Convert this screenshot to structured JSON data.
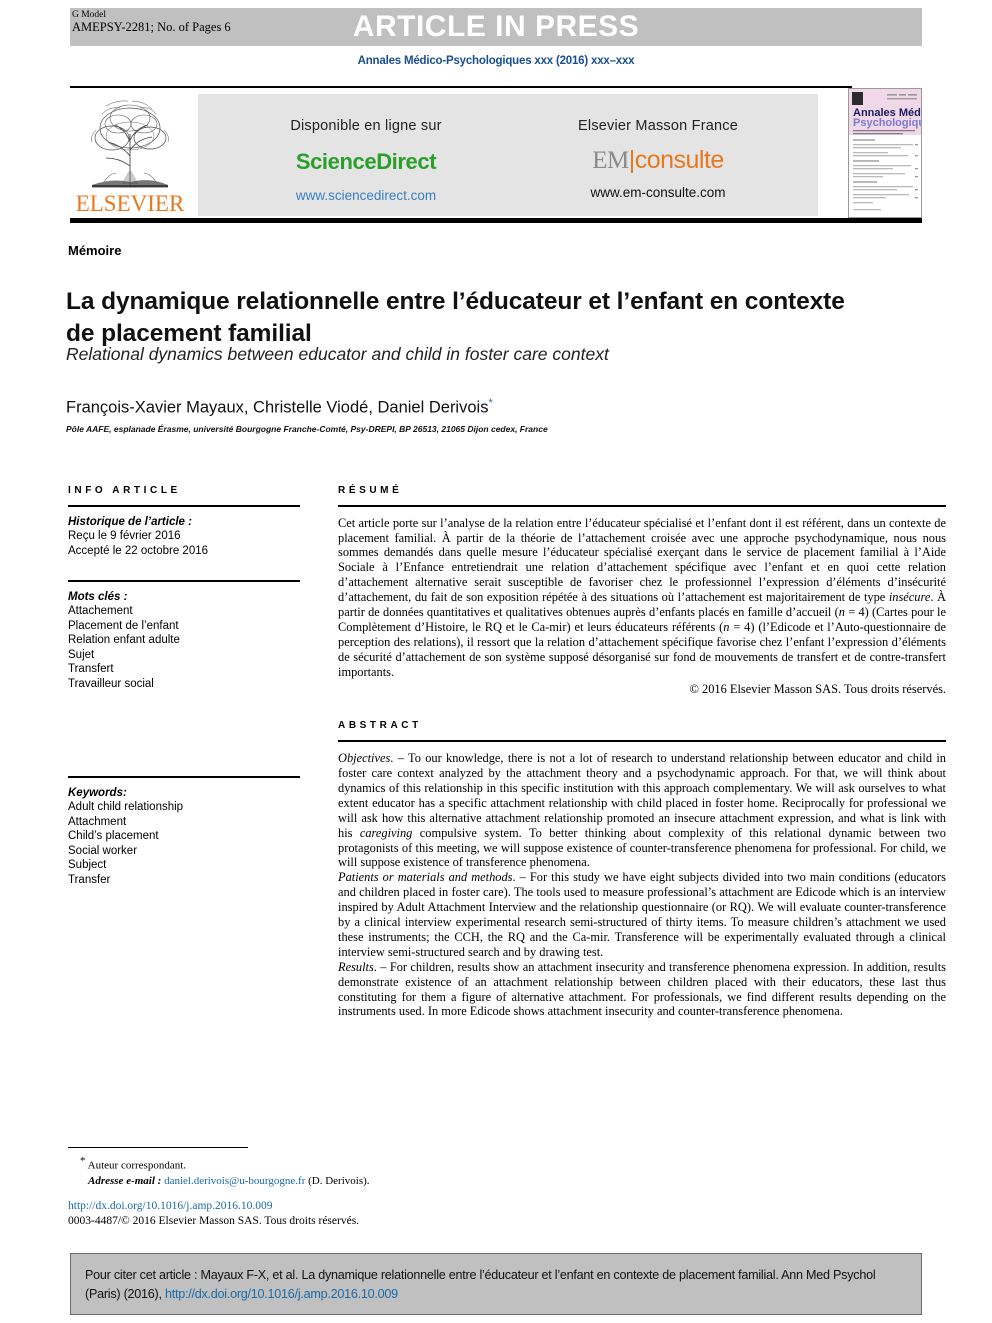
{
  "masthead": {
    "banner_text": "ARTICLE IN PRESS",
    "g_model_label": "G Model",
    "model_id": "AMEPSY-2281; No. of Pages 6",
    "journal_line": "Annales Médico-Psychologiques xxx (2016) xxx–xxx"
  },
  "banner": {
    "elsevier_wordmark": "ELSEVIER",
    "sciencedirect": {
      "label": "Disponible en ligne sur",
      "logo": "ScienceDirect",
      "url": "www.sciencedirect.com"
    },
    "emconsulte": {
      "label": "Elsevier Masson France",
      "logo_part1": "EM",
      "logo_part2": "consulte",
      "url": "www.em-consulte.com"
    },
    "cover": {
      "line1": "Annales Médico",
      "line2": "Psychologiques"
    }
  },
  "article": {
    "section_label": "Mémoire",
    "title_fr": "La dynamique relationnelle entre l’éducateur et l’enfant en contexte de placement familial",
    "title_en": "Relational dynamics between educator and child in foster care context",
    "authors": "François-Xavier Mayaux, Christelle Viodé, Daniel Derivois",
    "affiliation": "Pôle AAFE, esplanade Érasme, université Bourgogne Franche-Comté, Psy-DREPI, BP 26513, 21065 Dijon cedex, France"
  },
  "info_article": {
    "heading": "INFO ARTICLE",
    "history_label": "Historique de l’article :",
    "received": "Reçu le 9 février 2016",
    "accepted": "Accepté le 22 octobre 2016",
    "keywords_label": "Mots clés :",
    "keywords": [
      "Attachement",
      "Placement de l’enfant",
      "Relation enfant adulte",
      "Sujet",
      "Transfert",
      "Travailleur social"
    ],
    "keywords_en_label": "Keywords:",
    "keywords_en": [
      "Adult child relationship",
      "Attachment",
      "Child’s placement",
      "Social worker",
      "Subject",
      "Transfer"
    ]
  },
  "resume": {
    "heading": "RÉSUMÉ",
    "body_part1": "Cet article porte sur l’analyse de la relation entre l’éducateur spécialisé et l’enfant dont il est référent, dans un contexte de placement familial. À partir de la théorie de l’attachement croisée avec une approche psychodynamique, nous nous sommes demandés dans quelle mesure l’éducateur spécialisé exerçant dans le service de placement familial à l’Aide Sociale à l’Enfance entretiendrait une relation d’attachement spécifique avec l’enfant et en quoi cette relation d’attachement alternative serait susceptible de favoriser chez le professionnel l’expression d’éléments d’insécurité d’attachement, du fait de son exposition répétée à des situations où l’attachement est majoritairement de type ",
    "italic1": "insécure",
    "body_part2": ". À partir de données quantitatives et qualitatives obtenues auprès d’enfants placés en famille d’accueil (",
    "italic2": "n",
    "body_part3": " = 4) (Cartes pour le Complètement d’Histoire, le RQ et le Ca-mir) et leurs éducateurs référents (",
    "italic3": "n",
    "body_part4": " = 4) (l’Edicode et l’Auto-questionnaire de perception des relations), il ressort que la relation d’attachement spécifique favorise chez l’enfant l’expression d’éléments de sécurité d’attachement de son système supposé désorganisé sur fond de mouvements de transfert et de contre-transfert importants.",
    "copyright": "© 2016 Elsevier Masson SAS. Tous droits réservés."
  },
  "abstract": {
    "heading": "ABSTRACT",
    "objectives_label": "Objectives",
    "objectives_body": ". – To our knowledge, there is not a lot of research to understand relationship between educator and child in foster care context analyzed by the attachment theory and a psychodynamic approach. For that, we will think about dynamics of this relationship in this specific institution with this approach complementary. We will ask ourselves to what extent educator has a specific attachment relationship with child placed in foster home. Reciprocally for professional we will ask how this alternative attachment relationship promoted an insecure attachment expression, and what is link with his ",
    "objectives_italic": "caregiving",
    "objectives_body2": " compulsive system. To better thinking about complexity of this relational dynamic between two protagonists of this meeting, we will suppose existence of counter-transference phenomena for professional. For child, we will suppose existence of transference phenomena.",
    "methods_label": "Patients or materials and methods",
    "methods_body": ". – For this study we have eight subjects divided into two main conditions (educators and children placed in foster care). The tools used to measure professional’s attachment are Edicode which is an interview inspired by Adult Attachment Interview and the relationship questionnaire (or RQ). We will evaluate counter-transference by a clinical interview experimental research semi-structured of thirty items. To measure children’s attachment we used these instruments; the CCH, the RQ and the Ca-mir. Transference will be experimentally evaluated through a clinical interview semi-structured search and by drawing test.",
    "results_label": "Results",
    "results_body": ". – For children, results show an attachment insecurity and transference phenomena expression. In addition, results demonstrate existence of an attachment relationship between children placed with their educators, these last thus constituting for them a figure of alternative attachment. For professionals, we find different results depending on the instruments used. In more Edicode shows attachment insecurity and counter-transference phenomena."
  },
  "footer": {
    "corresponding_author": "Auteur correspondant.",
    "email_label": "Adresse e-mail :",
    "email": "daniel.derivois@u-bourgogne.fr",
    "email_suffix": "(D. Derivois).",
    "doi": "http://dx.doi.org/10.1016/j.amp.2016.10.009",
    "issn_line": "0003-4487/© 2016 Elsevier Masson SAS. Tous droits réservés."
  },
  "citation": {
    "text_part1": "Pour citer cet article : Mayaux F-X, et al. La dynamique relationnelle entre l’éducateur et l’enfant en contexte de placement familial. Ann Med Psychol (Paris) (2016), ",
    "link": "http://dx.doi.org/10.1016/j.amp.2016.10.009"
  },
  "colors": {
    "link": "#1a6aa8",
    "elsevier_orange": "#e8781e",
    "sciencedirect_green": "#2aa02a",
    "masthead_gray": "#c0c0c0"
  }
}
